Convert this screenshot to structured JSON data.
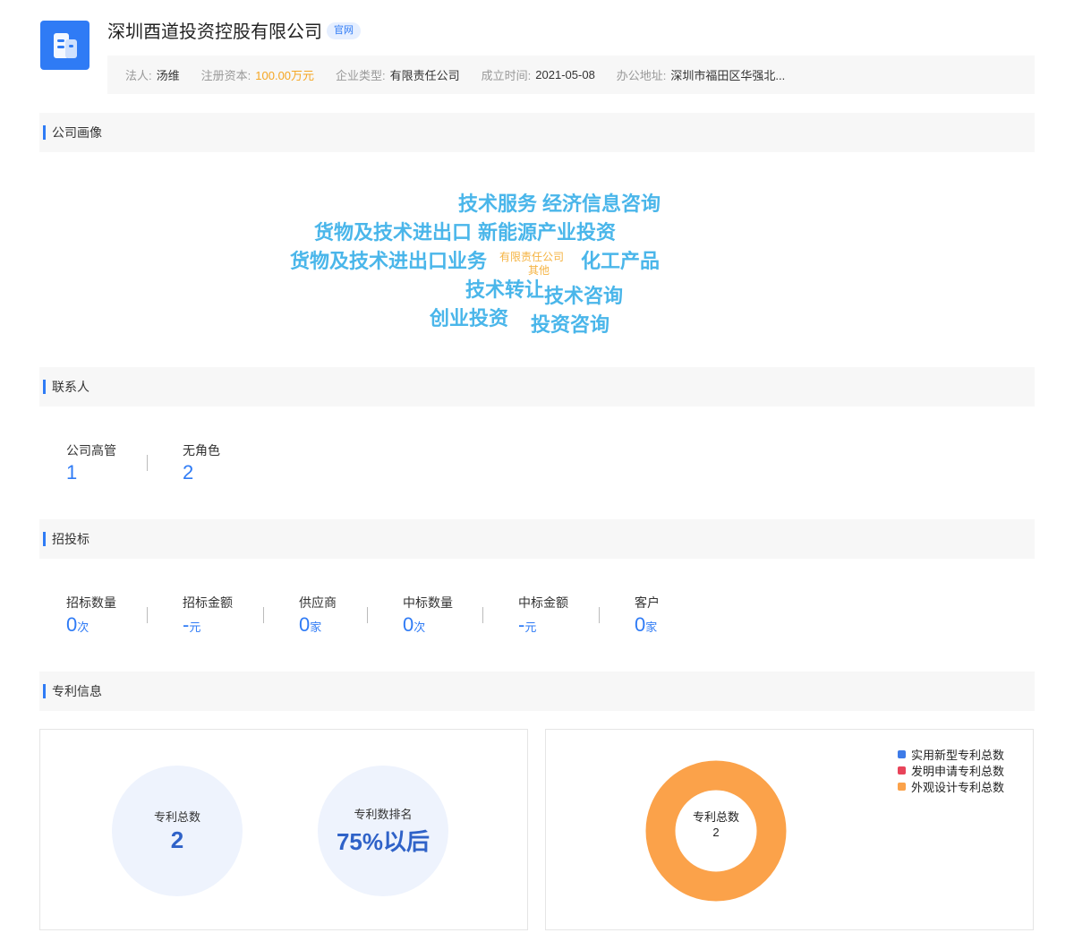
{
  "header": {
    "company_name": "深圳酉道投资控股有限公司",
    "official_badge": "官网",
    "logo_icon": "building-icon",
    "info": {
      "legal_rep_label": "法人:",
      "legal_rep_value": "汤维",
      "capital_label": "注册资本:",
      "capital_value": "100.00万元",
      "type_label": "企业类型:",
      "type_value": "有限责任公司",
      "founded_label": "成立时间:",
      "founded_value": "2021-05-08",
      "address_label": "办公地址:",
      "address_value": "深圳市福田区华强北..."
    }
  },
  "sections": {
    "portrait": "公司画像",
    "contacts": "联系人",
    "bidding": "招投标",
    "patents": "专利信息"
  },
  "word_cloud": [
    "技术服务",
    "经济信息咨询",
    "货物及技术进出口",
    "新能源产业投资",
    "货物及技术进出口业务",
    "有限责任公司",
    "其他",
    "化工产品",
    "技术转让",
    "技术咨询",
    "创业投资",
    "投资咨询"
  ],
  "contacts": [
    {
      "label": "公司高管",
      "value": "1"
    },
    {
      "label": "无角色",
      "value": "2"
    }
  ],
  "bidding": [
    {
      "label": "招标数量",
      "value": "0",
      "unit": "次"
    },
    {
      "label": "招标金额",
      "value": "-",
      "unit": "元"
    },
    {
      "label": "供应商",
      "value": "0",
      "unit": "家"
    },
    {
      "label": "中标数量",
      "value": "0",
      "unit": "次"
    },
    {
      "label": "中标金额",
      "value": "-",
      "unit": "元"
    },
    {
      "label": "客户",
      "value": "0",
      "unit": "家"
    }
  ],
  "patents": {
    "total_label": "专利总数",
    "total_value": "2",
    "rank_label": "专利数排名",
    "rank_value": "75%以后",
    "donut_center_label": "专利总数",
    "donut_center_value": "2"
  },
  "chart_data": {
    "type": "pie",
    "categories": [
      "实用新型专利总数",
      "发明申请专利总数",
      "外观设计专利总数"
    ],
    "values": [
      0,
      0,
      2
    ],
    "colors": [
      "#3d7be8",
      "#e8445a",
      "#fba24a"
    ],
    "legend": "top-right"
  }
}
